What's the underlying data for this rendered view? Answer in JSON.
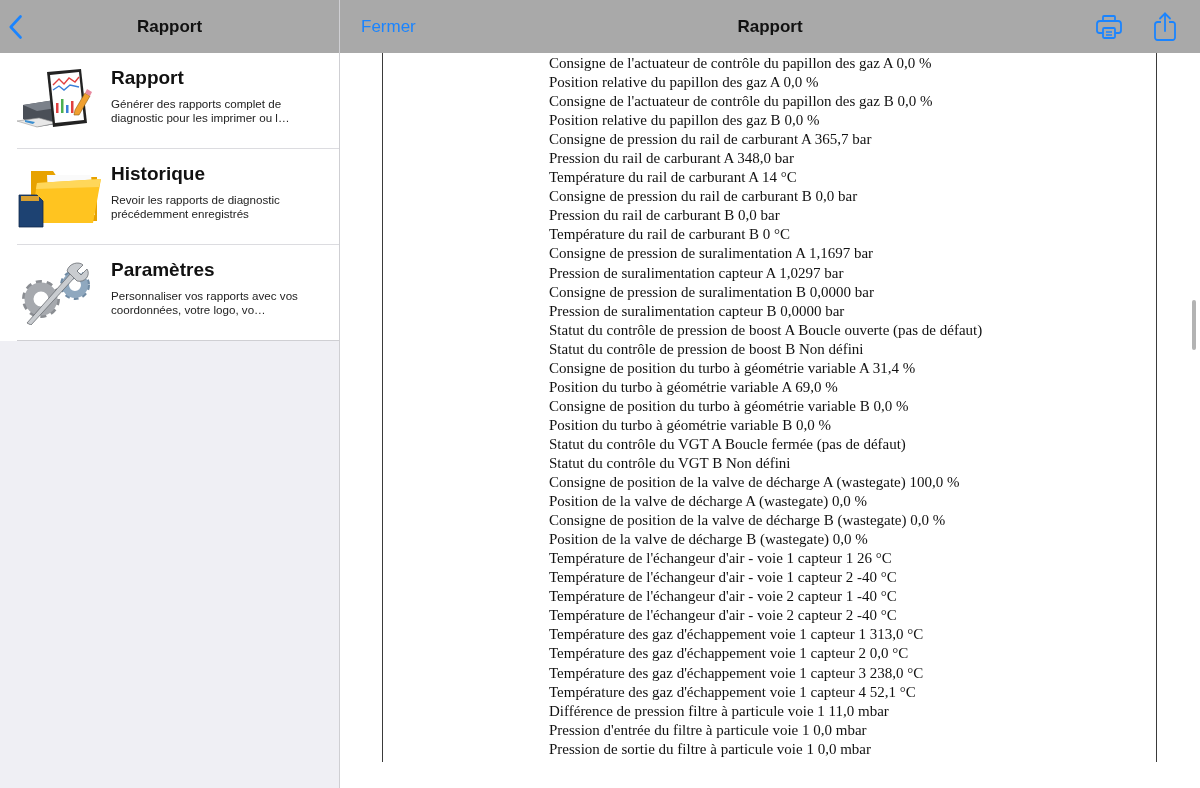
{
  "sidebar": {
    "title": "Rapport",
    "items": [
      {
        "kind": "report",
        "title": "Rapport",
        "description": "Générer des rapports complet de diagnostic pour les imprimer ou l…"
      },
      {
        "kind": "history",
        "title": "Historique",
        "description": "Revoir les rapports de diagnostic précédemment enregistrés"
      },
      {
        "kind": "settings",
        "title": "Paramètres",
        "description": "Personnaliser vos rapports avec vos coordonnées, votre logo, vo…"
      }
    ]
  },
  "viewer": {
    "close_label": "Fermer",
    "title": "Rapport",
    "document": {
      "lines": [
        "Consigne de l'actuateur de contrôle du papillon des gaz A 0,0 %",
        "Position relative du papillon des gaz A 0,0 %",
        "Consigne de l'actuateur de contrôle du papillon des gaz B 0,0 %",
        "Position relative du papillon des gaz B 0,0 %",
        "Consigne de pression du rail de carburant A 365,7 bar",
        "Pression du rail de carburant A 348,0 bar",
        "Température du rail de carburant A 14 °C",
        "Consigne de pression du rail de carburant B 0,0 bar",
        "Pression du rail de carburant B 0,0 bar",
        "Température du rail de carburant B 0 °C",
        "Consigne de pression de suralimentation A 1,1697 bar",
        "Pression de suralimentation capteur A 1,0297 bar",
        "Consigne de pression de suralimentation B 0,0000 bar",
        "Pression de suralimentation capteur B 0,0000 bar",
        "Statut du contrôle de pression de boost A Boucle ouverte (pas de défaut)",
        "Statut du contrôle de pression de boost B Non défini",
        "Consigne de position du turbo à géométrie variable A 31,4 %",
        "Position du turbo à géométrie variable A 69,0 %",
        "Consigne de position du turbo à géométrie variable B 0,0 %",
        "Position du turbo à géométrie variable B 0,0 %",
        "Statut du contrôle du VGT A Boucle fermée (pas de défaut)",
        "Statut du contrôle du VGT B Non défini",
        "Consigne de position de la valve de décharge A (wastegate) 100,0 %",
        "Position de la valve de décharge A (wastegate) 0,0 %",
        "Consigne de position de la valve de décharge B (wastegate) 0,0 %",
        "Position de la valve de décharge B (wastegate) 0,0 %",
        "Température de l'échangeur d'air - voie 1 capteur 1 26 °C",
        "Température de l'échangeur d'air - voie 1 capteur 2 -40 °C",
        "Température de l'échangeur d'air - voie 2 capteur 1 -40 °C",
        "Température de l'échangeur d'air - voie 2 capteur 2 -40 °C",
        "Température des gaz d'échappement voie 1 capteur 1 313,0 °C",
        "Température des gaz d'échappement voie 1 capteur 2 0,0 °C",
        "Température des gaz d'échappement voie 1 capteur 3 238,0 °C",
        "Température des gaz d'échappement voie 1 capteur 4 52,1 °C",
        "Différence de pression filtre à particule voie 1 11,0 mbar",
        "Pression d'entrée du filtre à particule voie 1 0,0 mbar",
        "Pression de sortie du filtre à particule voie 1 0,0 mbar"
      ]
    }
  }
}
